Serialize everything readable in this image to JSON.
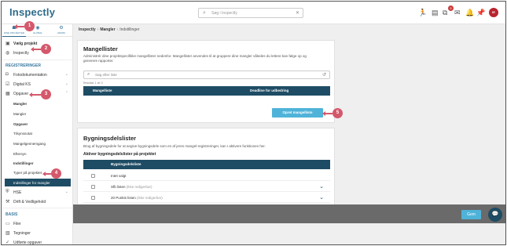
{
  "app": {
    "logo": "Inspectly"
  },
  "topbar": {
    "search_placeholder": "Søg i Inspectly",
    "notification_count": "5",
    "user_initials": "IE"
  },
  "sidebar": {
    "modes": [
      {
        "label": "DINE PROJEKTER",
        "icon": "home-icon"
      },
      {
        "label": "GLOBAL",
        "icon": "globe-icon"
      },
      {
        "label": "ADMIN",
        "icon": "gear-icon"
      }
    ],
    "choose_project": "Vælg projekt",
    "project": "Inspectly",
    "section_registreringer": "REGISTRERINGER",
    "items": [
      {
        "label": "Fotodokumentation"
      },
      {
        "label": "Digital KS"
      },
      {
        "label": "Opgaver"
      }
    ],
    "sub_items": [
      {
        "label": "Mangler",
        "bold": true
      },
      {
        "label": "Mangler",
        "bold": false
      },
      {
        "label": "Opgaver",
        "bold": true
      },
      {
        "label": "Tilsynsnotat",
        "bold": false
      },
      {
        "label": "Mangelgennemgang",
        "bold": false
      },
      {
        "label": "Eftersyn",
        "bold": false
      },
      {
        "label": "Indstillinger",
        "bold": true
      },
      {
        "label": "Typer på projektet",
        "bold": false
      },
      {
        "label": "Indstillinger for mangler",
        "bold": false
      }
    ],
    "items_after": [
      {
        "label": "HSE"
      },
      {
        "label": "Drift & Vedligehold"
      }
    ],
    "section_basis": "BASIS",
    "basis_items": [
      {
        "label": "Filer"
      },
      {
        "label": "Tegninger"
      },
      {
        "label": "Udførte opgaver"
      }
    ]
  },
  "breadcrumb": [
    "Inspectly",
    "Mangler",
    "Indstillinger"
  ],
  "mangellister": {
    "title": "Mangellister",
    "description": "Administrér dine projektspecifikke mangellister nedenfor. Mangellister anvendes til at gruppere dine mangler således du lettere kan følge op og generere rapporter.",
    "filter_placeholder": "Søg efter liste",
    "count": "Resultat: 1 af: 0",
    "columns": [
      "Mangelliste",
      "Deadline for udbedring"
    ],
    "create_button": "Opret mangelliste"
  },
  "bygningsdelslister": {
    "title": "Bygningsdelslister",
    "description": "Brug af bygningsdele for at angive bygningsdele som en af jeres mangel-registreringer, kan I aktivere funktionen her.",
    "subtitle": "Aktiver bygningsdelslister på projektet",
    "column": "Bygningsdelsliste",
    "rows": [
      {
        "label": "Intet valgt",
        "muted": "",
        "expandable": false
      },
      {
        "label": "Sfb listen",
        "muted": "(ikke redigerbar)",
        "expandable": true
      },
      {
        "label": "20 Punkts listen",
        "muted": "(ikke redigerbar)",
        "expandable": true
      }
    ]
  },
  "footer": {
    "save_label": "Gem"
  },
  "markers": [
    "1",
    "2",
    "3",
    "4",
    "5"
  ],
  "colors": {
    "primary": "#1e4c64",
    "accent": "#4fb3d9",
    "marker": "#d4586b",
    "brand": "#2d6a8a"
  }
}
